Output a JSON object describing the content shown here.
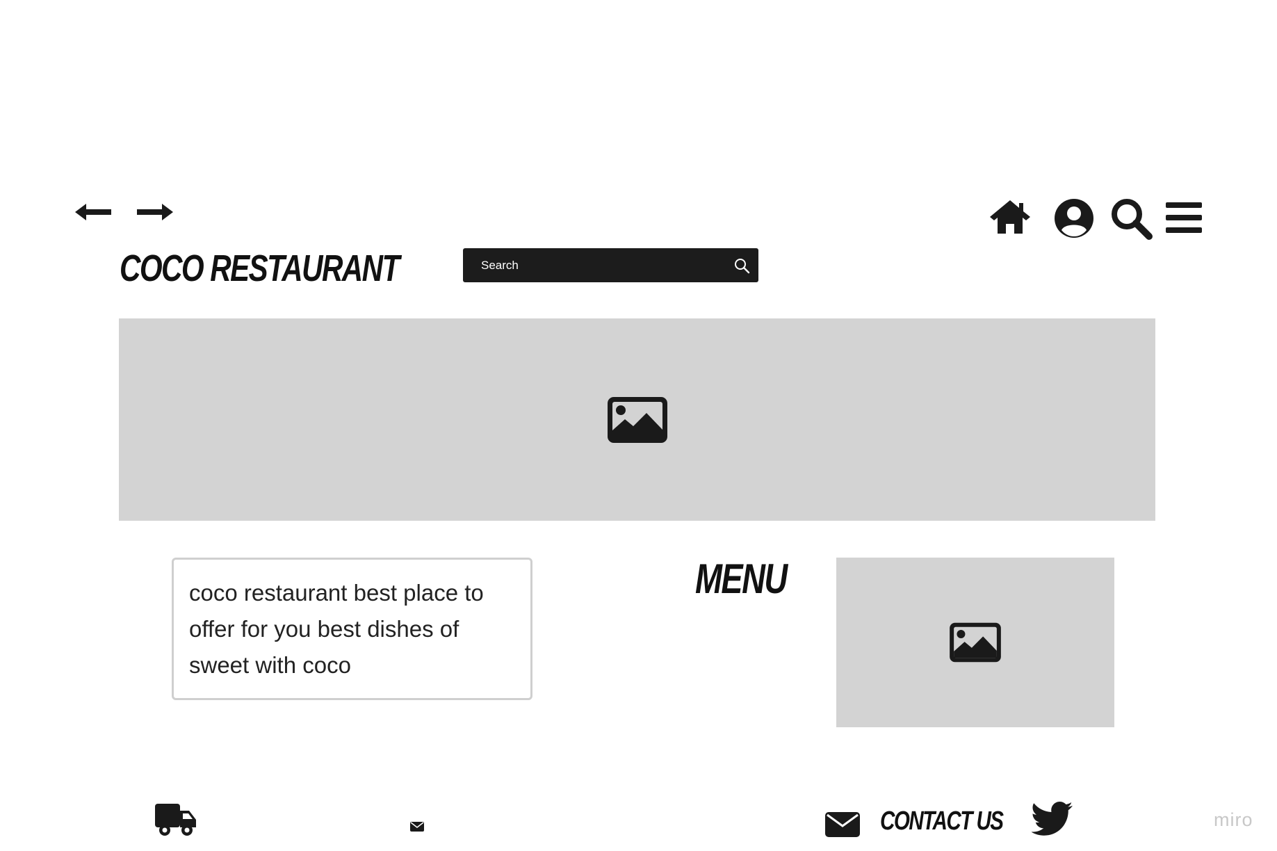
{
  "nav": {
    "back_icon": "arrow-left-icon",
    "forward_icon": "arrow-right-icon"
  },
  "toolbar": {
    "icons": [
      "home-icon",
      "user-circle-icon",
      "search-icon",
      "hamburger-menu-icon"
    ]
  },
  "brand": {
    "title": "COCO RESTAURANT"
  },
  "search": {
    "placeholder": "Search",
    "icon": "search-icon"
  },
  "hero": {
    "icon": "image-icon"
  },
  "about": {
    "text": "coco restaurant best place to offer for you  best dishes of sweet with coco"
  },
  "menu": {
    "heading": "MENU",
    "icon": "image-icon"
  },
  "footer": {
    "delivery_icon": "truck-icon",
    "mail_small_icon": "envelope-icon",
    "contact_icon": "envelope-icon",
    "contact_label": "CONTACT US",
    "social_icon": "twitter-icon"
  },
  "watermark": {
    "text": "miro"
  },
  "colors": {
    "dark": "#1c1c1c",
    "placeholder": "#d3d3d3",
    "border": "#cfcfcf"
  }
}
